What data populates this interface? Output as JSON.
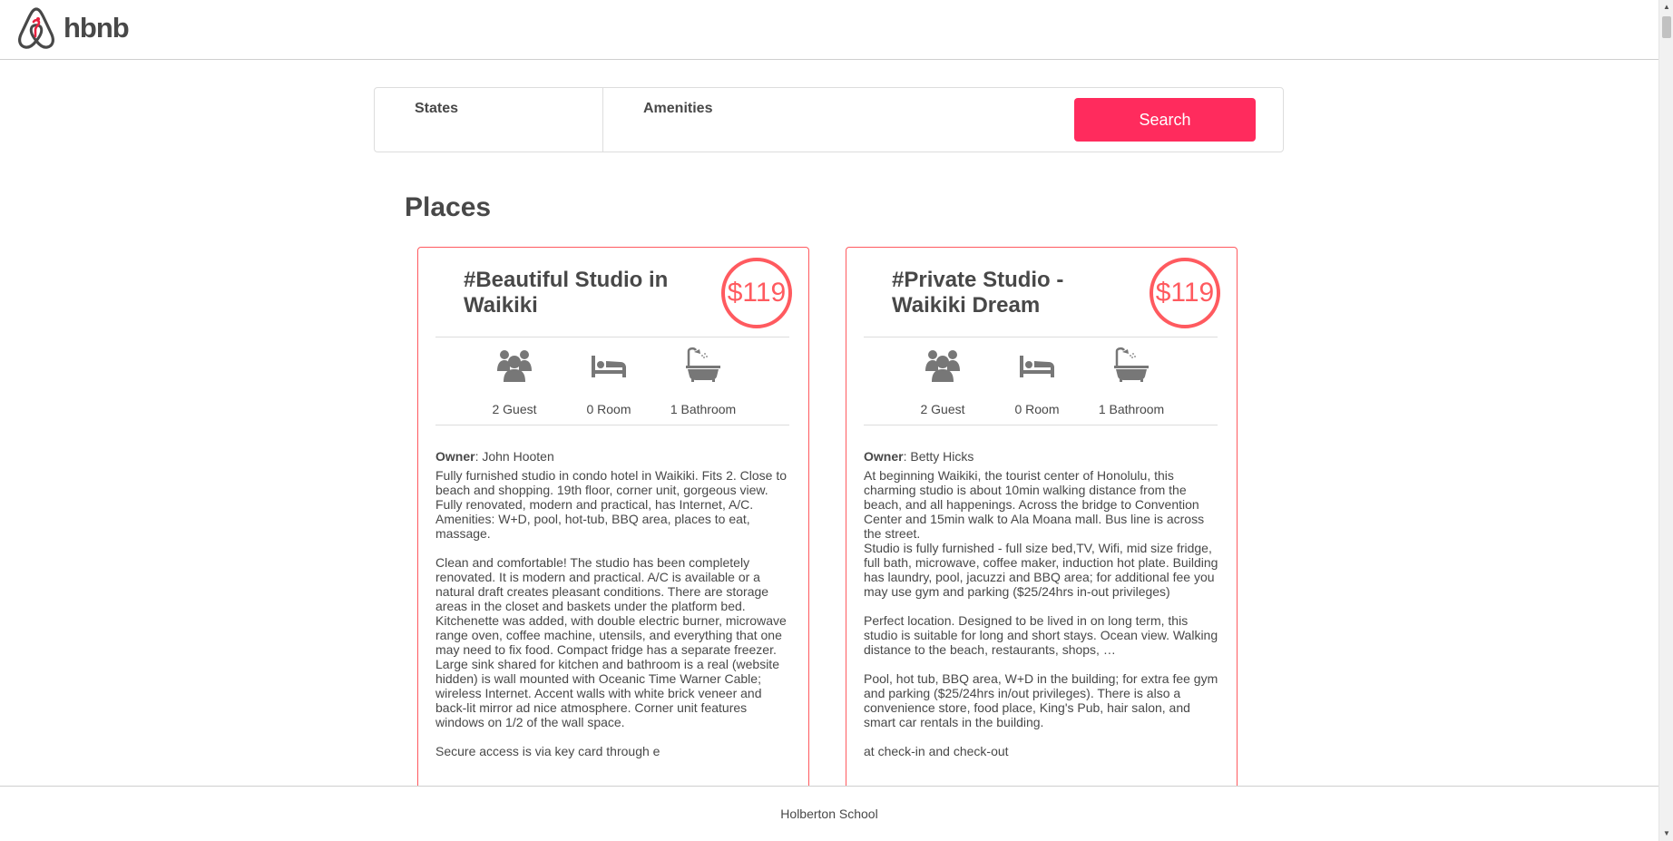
{
  "header": {
    "logo_text": "hbnb"
  },
  "filters": {
    "states_label": "States",
    "amenities_label": "Amenities",
    "search_label": "Search"
  },
  "places": {
    "title": "Places",
    "items": [
      {
        "name": "#Beautiful Studio in Waikiki",
        "price": "$119",
        "guests": "2 Guest",
        "rooms": "0 Room",
        "bathrooms": "1 Bathroom",
        "owner_label": "Owner",
        "owner": ": John Hooten",
        "description": [
          "Fully furnished studio in condo hotel in Waikiki. Fits 2. Close to beach and shopping. 19th floor, corner unit, gorgeous view. Fully renovated, modern and practical, has Internet, A/C. Amenities: W+D, pool, hot-tub, BBQ area, places to eat, massage.",
          "Clean and comfortable! The studio has been completely renovated. It is modern and practical. A/C is available or a natural draft creates pleasant conditions. There are storage areas in the closet and baskets under the platform bed. Kitchenette was added, with double electric burner, microwave range oven, coffee machine, utensils, and everything that one may need to fix food. Compact fridge has a separate freezer. Large sink shared for kitchen and bathroom is a real (website hidden) is wall mounted with Oceanic Time Warner Cable; wireless Internet. Accent walls with white brick veneer and back-lit mirror ad nice atmosphere. Corner unit features windows on 1/2 of the wall space.",
          "Secure access is via key card through e"
        ]
      },
      {
        "name": "#Private Studio - Waikiki Dream",
        "price": "$119",
        "guests": "2 Guest",
        "rooms": "0 Room",
        "bathrooms": "1 Bathroom",
        "owner_label": "Owner",
        "owner": ": Betty Hicks",
        "description": [
          "At beginning Waikiki, the tourist center of Honolulu, this charming studio is about 10min walking distance from the beach, and all happenings. Across the bridge to Convention Center and 15min walk to Ala Moana mall. Bus line is across the street.",
          "Studio is fully furnished - full size bed,TV, Wifi, mid size fridge, full bath, microwave, coffee maker, induction hot plate. Building has laundry, pool, jacuzzi and BBQ area; for additional fee you may use gym and parking ($25/24hrs in-out privileges)",
          "Perfect location. Designed to be lived in on long term, this studio is suitable for long and short stays. Ocean view. Walking distance to the beach, restaurants, shops, …",
          "Pool, hot tub, BBQ area, W+D in the building; for extra fee gym and parking ($25/24hrs in/out privileges). There is also a convenience store, food place, King's Pub, hair salon, and smart car rentals in the building.",
          "at check-in and check-out"
        ]
      }
    ]
  },
  "footer": {
    "text": "Holberton School"
  },
  "colors": {
    "accent": "#ff5a5f",
    "search_button": "#ff2b5d",
    "text": "#484848",
    "border": "#dddddd"
  }
}
